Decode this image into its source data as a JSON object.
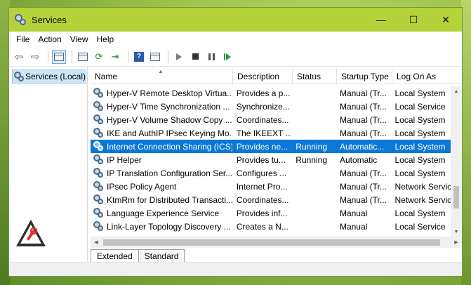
{
  "window": {
    "title": "Services"
  },
  "controls": {
    "minimize": "—",
    "maximize": "☐",
    "close": "✕"
  },
  "menu": [
    "File",
    "Action",
    "View",
    "Help"
  ],
  "tree": {
    "label": "Services (Local)"
  },
  "columns": {
    "name": "Name",
    "description": "Description",
    "status": "Status",
    "startup": "Startup Type",
    "logon": "Log On As"
  },
  "services": [
    {
      "name": "Hyper-V Remote Desktop Virtua...",
      "description": "Provides a p...",
      "status": "",
      "startup": "Manual (Tr...",
      "logon": "Local System"
    },
    {
      "name": "Hyper-V Time Synchronization ...",
      "description": "Synchronize...",
      "status": "",
      "startup": "Manual (Tr...",
      "logon": "Local Service"
    },
    {
      "name": "Hyper-V Volume Shadow Copy ...",
      "description": "Coordinates...",
      "status": "",
      "startup": "Manual (Tr...",
      "logon": "Local System"
    },
    {
      "name": "IKE and AuthIP IPsec Keying Mo...",
      "description": "The IKEEXT ...",
      "status": "",
      "startup": "Manual (Tr...",
      "logon": "Local System"
    },
    {
      "name": "Internet Connection Sharing (ICS)",
      "description": "Provides ne...",
      "status": "Running",
      "startup": "Automatic...",
      "logon": "Local System"
    },
    {
      "name": "IP Helper",
      "description": "Provides tu...",
      "status": "Running",
      "startup": "Automatic",
      "logon": "Local System"
    },
    {
      "name": "IP Translation Configuration Ser...",
      "description": "Configures ...",
      "status": "",
      "startup": "Manual (Tr...",
      "logon": "Local System"
    },
    {
      "name": "IPsec Policy Agent",
      "description": "Internet Pro...",
      "status": "",
      "startup": "Manual (Tr...",
      "logon": "Network Servic"
    },
    {
      "name": "KtmRm for Distributed Transacti...",
      "description": "Coordinates...",
      "status": "",
      "startup": "Manual (Tr...",
      "logon": "Network Servic"
    },
    {
      "name": "Language Experience Service",
      "description": "Provides inf...",
      "status": "",
      "startup": "Manual",
      "logon": "Local System"
    },
    {
      "name": "Link-Layer Topology Discovery ...",
      "description": "Creates a N...",
      "status": "",
      "startup": "Manual",
      "logon": "Local Service"
    }
  ],
  "selected_index": 4,
  "tabs": [
    "Extended",
    "Standard"
  ],
  "colors": {
    "titlebar": "#b6d23a",
    "selection": "#0a78d7"
  }
}
